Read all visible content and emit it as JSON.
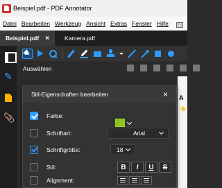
{
  "window": {
    "title": "Beispiel.pdf - PDF Annotator"
  },
  "menu": [
    "Datei",
    "Bearbeiten",
    "Werkzeug",
    "Ansicht",
    "Extras",
    "Fenster",
    "Hilfe"
  ],
  "tabs": [
    {
      "label": "Beispiel.pdf",
      "active": true,
      "close": "×"
    },
    {
      "label": "Kamera.pdf",
      "active": false
    }
  ],
  "toolbar": {
    "mode_label": "Auswählen"
  },
  "dialog": {
    "title": "Stil-Eigenschaften bearbeiten",
    "close": "×",
    "rows": {
      "color": {
        "label": "Farbe:",
        "checked": true,
        "value": "#8bc21c"
      },
      "font": {
        "label": "Schriftart:",
        "checked": false,
        "value": "Arial"
      },
      "size": {
        "label": "Schriftgröße:",
        "checked": true,
        "value": "18"
      },
      "style": {
        "label": "Stil:",
        "checked": false,
        "buttons": [
          "B",
          "I",
          "U",
          "S"
        ]
      },
      "alignment": {
        "label": "Alignment:",
        "checked": false
      }
    }
  },
  "page": {
    "visible_letter": "A"
  },
  "colors": {
    "accent": "#2e9bff",
    "swatch": "#8bc21c"
  }
}
